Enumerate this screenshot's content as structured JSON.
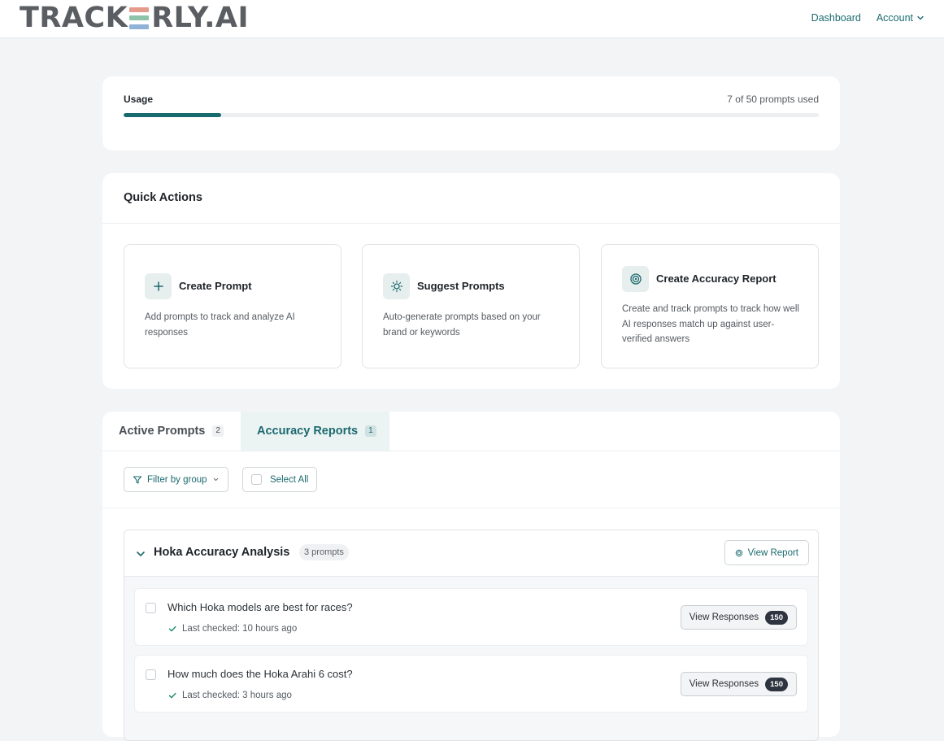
{
  "header": {
    "logo_left": "TRACK",
    "logo_right": "RLY.AI",
    "logo_mark_colors": [
      "#e59b8c",
      "#8dc3a8",
      "#8fb2d6"
    ],
    "nav": {
      "dashboard": "Dashboard",
      "account": "Account"
    }
  },
  "usage": {
    "label": "Usage",
    "count_text": "7 of 50 prompts used",
    "used": 7,
    "limit": 50
  },
  "quick_actions": {
    "title": "Quick Actions",
    "items": [
      {
        "title": "Create Prompt",
        "description": "Add prompts to track and analyze AI responses",
        "icon": "plus-icon"
      },
      {
        "title": "Suggest Prompts",
        "description": "Auto-generate prompts based on your brand or keywords",
        "icon": "lightbulb-icon"
      },
      {
        "title": "Create Accuracy Report",
        "description": "Create and track prompts to track how well AI responses match up against user-verified answers",
        "icon": "target-icon"
      }
    ]
  },
  "tabs": [
    {
      "label": "Active Prompts",
      "count": "2"
    },
    {
      "label": "Accuracy Reports",
      "count": "1"
    }
  ],
  "toolbar": {
    "filter_label": "Filter by group",
    "select_all_label": "Select All"
  },
  "group": {
    "name": "Hoka Accuracy Analysis",
    "count_label": "3 prompts",
    "view_report_label": "View Report",
    "prompts": [
      {
        "text": "Which Hoka models are best for races?",
        "last_checked": "Last checked: 10 hours ago",
        "button_label": "View Responses",
        "responses": "150"
      },
      {
        "text": "How much does the Hoka Arahi 6 cost?",
        "last_checked": "Last checked: 3 hours ago",
        "button_label": "View Responses",
        "responses": "150"
      }
    ]
  },
  "colors": {
    "accent": "#1b6a6e",
    "background": "#f3f4f5"
  }
}
